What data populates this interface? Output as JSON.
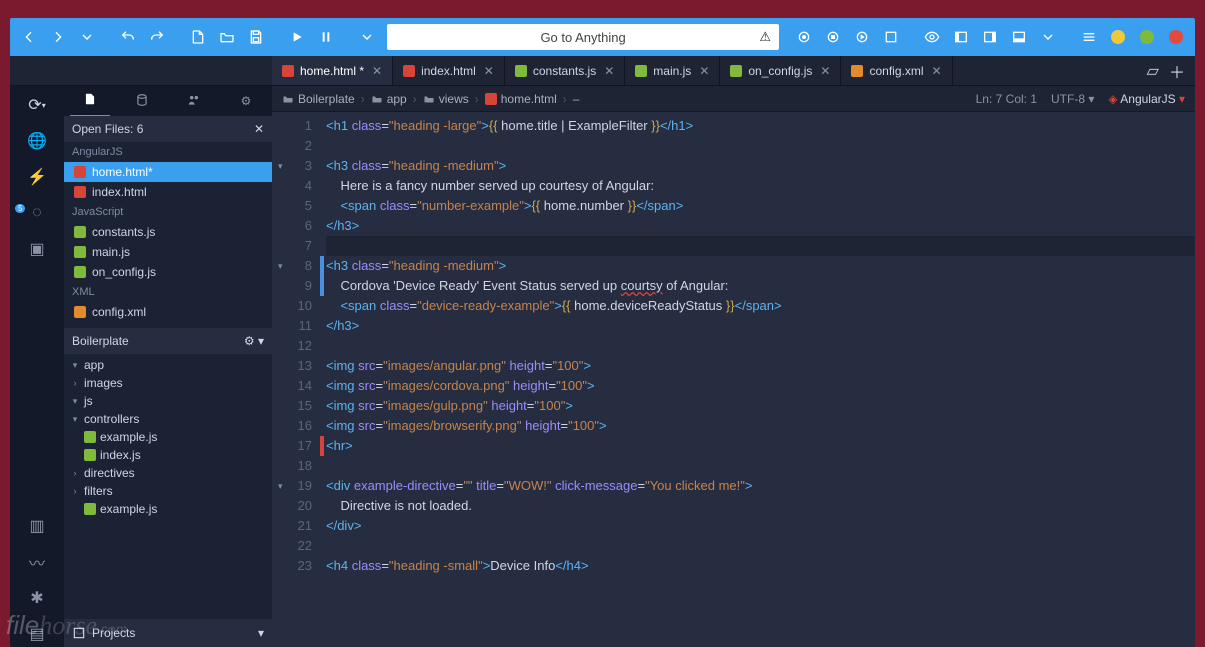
{
  "toolbar": {
    "search_placeholder": "Go to Anything"
  },
  "tabs": [
    {
      "icon": "red",
      "label": "home.html *",
      "active": true
    },
    {
      "icon": "red",
      "label": "index.html",
      "active": false
    },
    {
      "icon": "grn",
      "label": "constants.js",
      "active": false
    },
    {
      "icon": "grn",
      "label": "main.js",
      "active": false
    },
    {
      "icon": "grn",
      "label": "on_config.js",
      "active": false
    },
    {
      "icon": "org",
      "label": "config.xml",
      "active": false
    }
  ],
  "openfiles": {
    "title": "Open Files: 6",
    "groups": [
      {
        "label": "AngularJS",
        "items": [
          {
            "icon": "red",
            "name": "home.html*",
            "sel": true
          },
          {
            "icon": "red",
            "name": "index.html",
            "sel": false
          }
        ]
      },
      {
        "label": "JavaScript",
        "items": [
          {
            "icon": "grn",
            "name": "constants.js"
          },
          {
            "icon": "grn",
            "name": "main.js"
          },
          {
            "icon": "grn",
            "name": "on_config.js"
          }
        ]
      },
      {
        "label": "XML",
        "items": [
          {
            "icon": "org",
            "name": "config.xml"
          }
        ]
      }
    ]
  },
  "project": {
    "title": "Boilerplate",
    "tree": [
      {
        "d": 1,
        "chev": "▾",
        "label": "app"
      },
      {
        "d": 2,
        "chev": "›",
        "label": "images"
      },
      {
        "d": 2,
        "chev": "▾",
        "label": "js"
      },
      {
        "d": 3,
        "chev": "▾",
        "label": "controllers"
      },
      {
        "d": 4,
        "chev": "",
        "icon": "grn",
        "label": "example.js"
      },
      {
        "d": 4,
        "chev": "",
        "icon": "grn",
        "label": "index.js"
      },
      {
        "d": 3,
        "chev": "›",
        "label": "directives"
      },
      {
        "d": 3,
        "chev": "›",
        "label": "filters"
      },
      {
        "d": 4,
        "chev": "",
        "icon": "grn",
        "label": "example.js"
      }
    ],
    "footer": "Projects"
  },
  "breadcrumbs": [
    {
      "icon": "folder",
      "label": "Boilerplate"
    },
    {
      "icon": "folder",
      "label": "app"
    },
    {
      "icon": "folder",
      "label": "views"
    },
    {
      "icon": "red",
      "label": "home.html"
    },
    {
      "icon": "",
      "label": "–"
    }
  ],
  "status": {
    "pos": "Ln: 7 Col: 1",
    "enc": "UTF-8",
    "lang": "AngularJS"
  },
  "code": {
    "lines": [
      {
        "n": 1,
        "fold": "",
        "html": "<span class='c-tag'>&lt;h1</span> <span class='c-attr'>class</span>=<span class='c-str'>\"heading -large\"</span><span class='c-tag'>&gt;</span><span class='c-brace'>{{</span> <span class='c-var'>home</span>.<span class='c-var'>title</span> | <span class='c-var'>ExampleFilter</span> <span class='c-brace'>}}</span><span class='c-tag'>&lt;/h1&gt;</span>"
      },
      {
        "n": 2,
        "fold": "",
        "html": ""
      },
      {
        "n": 3,
        "fold": "▾",
        "html": "<span class='c-tag'>&lt;h3</span> <span class='c-attr'>class</span>=<span class='c-str'>\"heading -medium\"</span><span class='c-tag'>&gt;</span>"
      },
      {
        "n": 4,
        "fold": "",
        "html": "    <span class='c-txt'>Here is a fancy number served up courtesy of Angular:</span>"
      },
      {
        "n": 5,
        "fold": "",
        "html": "    <span class='c-tag'>&lt;span</span> <span class='c-attr'>class</span>=<span class='c-str'>\"number-example\"</span><span class='c-tag'>&gt;</span><span class='c-brace'>{{</span> <span class='c-var'>home</span>.<span class='c-var'>number</span> <span class='c-brace'>}}</span><span class='c-tag'>&lt;/span&gt;</span>"
      },
      {
        "n": 6,
        "fold": "",
        "html": "<span class='c-tag'>&lt;/h3&gt;</span>"
      },
      {
        "n": 7,
        "fold": "",
        "hl": true,
        "html": ""
      },
      {
        "n": 8,
        "fold": "▾",
        "mark": "b",
        "html": "<span class='c-tag'>&lt;h3</span> <span class='c-attr'>class</span>=<span class='c-str'>\"heading -medium\"</span><span class='c-tag'>&gt;</span>"
      },
      {
        "n": 9,
        "fold": "",
        "mark": "b",
        "html": "    <span class='c-txt'>Cordova 'Device Ready' Event Status served up <span class='underline-err'>courtsy</span> of Angular:</span>"
      },
      {
        "n": 10,
        "fold": "",
        "html": "    <span class='c-tag'>&lt;span</span> <span class='c-attr'>class</span>=<span class='c-str'>\"device-ready-example\"</span><span class='c-tag'>&gt;</span><span class='c-brace'>{{</span> <span class='c-var'>home</span>.<span class='c-var'>deviceReadyStatus</span> <span class='c-brace'>}}</span><span class='c-tag'>&lt;/span&gt;</span>"
      },
      {
        "n": 11,
        "fold": "",
        "html": "<span class='c-tag'>&lt;/h3&gt;</span>"
      },
      {
        "n": 12,
        "fold": "",
        "html": ""
      },
      {
        "n": 13,
        "fold": "",
        "html": "<span class='c-tag'>&lt;img</span> <span class='c-attr'>src</span>=<span class='c-str'>\"images/angular.png\"</span> <span class='c-attr'>height</span>=<span class='c-str'>\"100\"</span><span class='c-tag'>&gt;</span>"
      },
      {
        "n": 14,
        "fold": "",
        "html": "<span class='c-tag'>&lt;img</span> <span class='c-attr'>src</span>=<span class='c-str'>\"images/cordova.png\"</span> <span class='c-attr'>height</span>=<span class='c-str'>\"100\"</span><span class='c-tag'>&gt;</span>"
      },
      {
        "n": 15,
        "fold": "",
        "html": "<span class='c-tag'>&lt;img</span> <span class='c-attr'>src</span>=<span class='c-str'>\"images/gulp.png\"</span> <span class='c-attr'>height</span>=<span class='c-str'>\"100\"</span><span class='c-tag'>&gt;</span>"
      },
      {
        "n": 16,
        "fold": "",
        "html": "<span class='c-tag'>&lt;img</span> <span class='c-attr'>src</span>=<span class='c-str'>\"images/browserify.png\"</span> <span class='c-attr'>height</span>=<span class='c-str'>\"100\"</span><span class='c-tag'>&gt;</span>"
      },
      {
        "n": 17,
        "fold": "",
        "mark": "r",
        "html": "<span class='c-tag'>&lt;hr&gt;</span>"
      },
      {
        "n": 18,
        "fold": "",
        "html": ""
      },
      {
        "n": 19,
        "fold": "▾",
        "html": "<span class='c-tag'>&lt;div</span> <span class='c-attr'>example-directive</span>=<span class='c-str'>\"\"</span> <span class='c-attr'>title</span>=<span class='c-str'>\"WOW!\"</span> <span class='c-attr'>click-message</span>=<span class='c-str'>\"You clicked me!\"</span><span class='c-tag'>&gt;</span>"
      },
      {
        "n": 20,
        "fold": "",
        "html": "    <span class='c-txt'>Directive is not loaded.</span>"
      },
      {
        "n": 21,
        "fold": "",
        "html": "<span class='c-tag'>&lt;/div&gt;</span>"
      },
      {
        "n": 22,
        "fold": "",
        "html": ""
      },
      {
        "n": 23,
        "fold": "",
        "html": "<span class='c-tag'>&lt;h4</span> <span class='c-attr'>class</span>=<span class='c-str'>\"heading -small\"</span><span class='c-tag'>&gt;</span><span class='c-txt'>Device Info</span><span class='c-tag'>&lt;/h4&gt;</span>"
      }
    ]
  },
  "watermark": "filehorse.com"
}
